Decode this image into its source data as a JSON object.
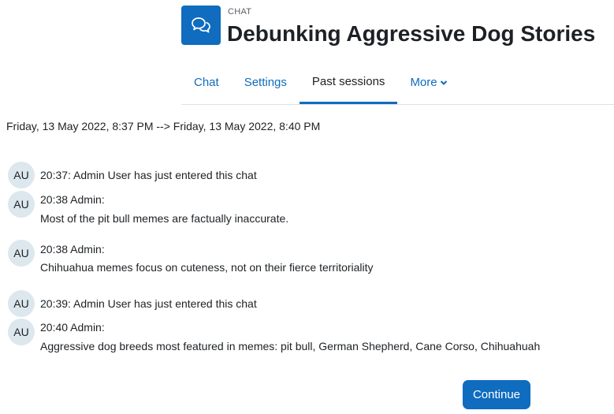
{
  "header": {
    "pretitle": "CHAT",
    "title": "Debunking Aggressive Dog Stories",
    "icon": "chat-bubbles-icon",
    "accent": "#0f6cbf"
  },
  "nav": {
    "tabs": [
      {
        "label": "Chat",
        "active": false
      },
      {
        "label": "Settings",
        "active": false
      },
      {
        "label": "Past sessions",
        "active": true
      },
      {
        "label": "More",
        "active": false
      }
    ]
  },
  "session": {
    "range": "Friday, 13 May 2022, 8:37 PM --> Friday, 13 May 2022, 8:40 PM"
  },
  "messages": [
    {
      "avatar": "AU",
      "header": "20:37: Admin User has just entered this chat",
      "text": ""
    },
    {
      "avatar": "AU",
      "header": "20:38 Admin:",
      "text": "Most of the pit bull memes are factually inaccurate."
    },
    {
      "avatar": "AU",
      "header": "20:38 Admin:",
      "text": "Chihuahua memes focus on cuteness, not on their fierce territoriality"
    },
    {
      "avatar": "AU",
      "header": "20:39: Admin User has just entered this chat",
      "text": ""
    },
    {
      "avatar": "AU",
      "header": "20:40 Admin:",
      "text": "Aggressive dog breeds most featured in memes: pit bull, German Shepherd, Cane Corso, Chihuahuah"
    }
  ],
  "actions": {
    "continue_label": "Continue"
  }
}
